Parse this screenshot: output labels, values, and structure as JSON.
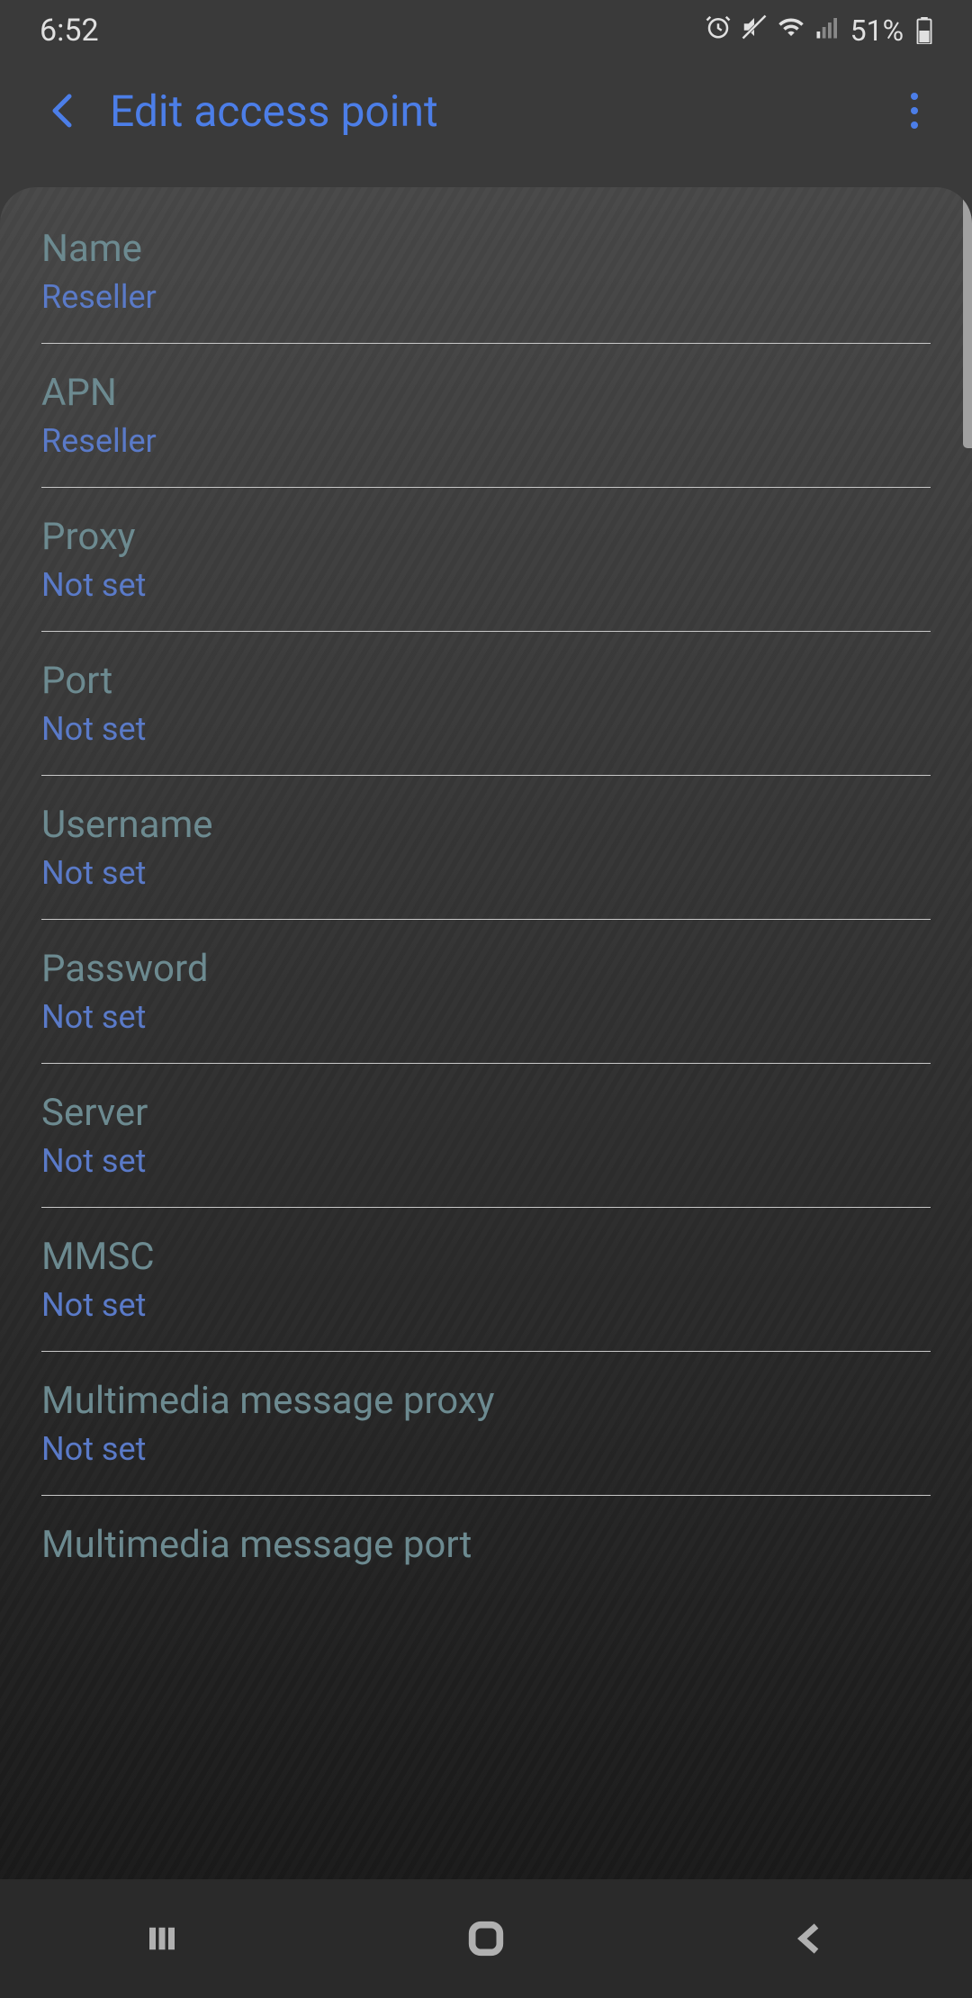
{
  "statusBar": {
    "time": "6:52",
    "battery": "51%"
  },
  "header": {
    "title": "Edit access point"
  },
  "items": [
    {
      "label": "Name",
      "value": "Reseller",
      "key": "name"
    },
    {
      "label": "APN",
      "value": "Reseller",
      "key": "apn"
    },
    {
      "label": "Proxy",
      "value": "Not set",
      "key": "proxy"
    },
    {
      "label": "Port",
      "value": "Not set",
      "key": "port"
    },
    {
      "label": "Username",
      "value": "Not set",
      "key": "username"
    },
    {
      "label": "Password",
      "value": "Not set",
      "key": "password"
    },
    {
      "label": "Server",
      "value": "Not set",
      "key": "server"
    },
    {
      "label": "MMSC",
      "value": "Not set",
      "key": "mmsc"
    },
    {
      "label": "Multimedia message proxy",
      "value": "Not set",
      "key": "mms-proxy"
    },
    {
      "label": "Multimedia message port",
      "value": "",
      "key": "mms-port"
    }
  ]
}
